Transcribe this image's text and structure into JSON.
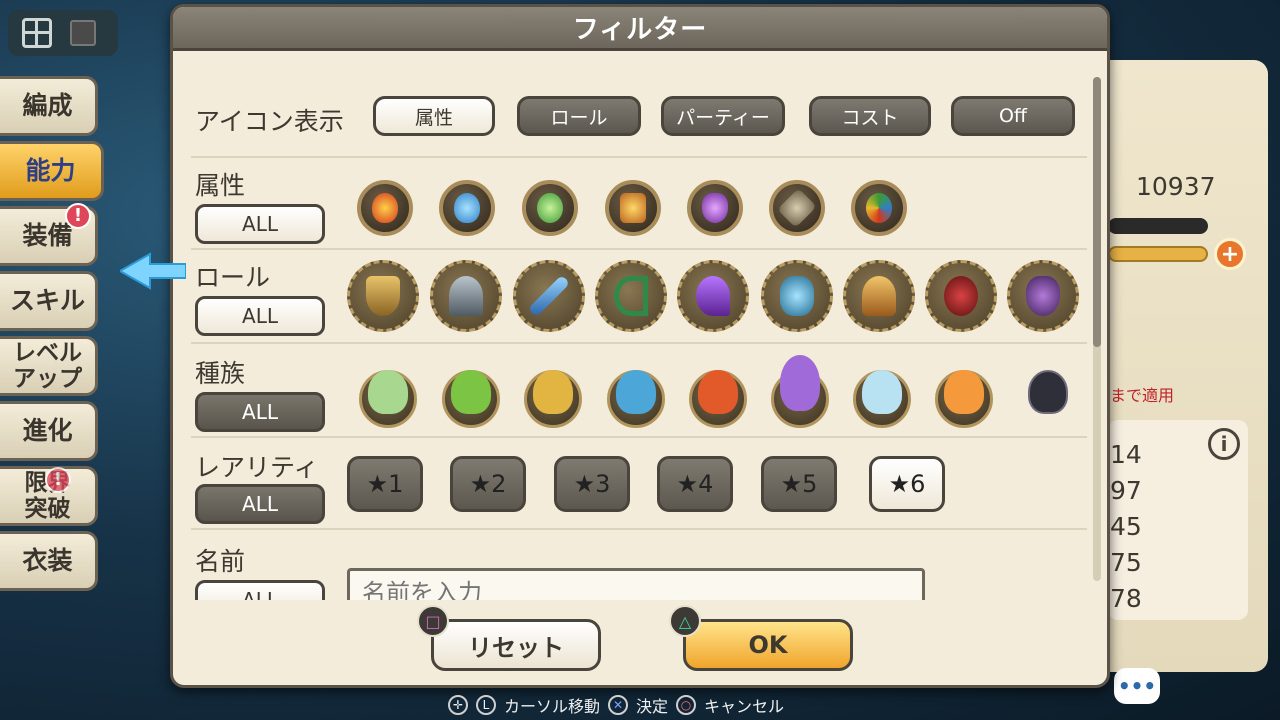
{
  "dialog": {
    "title": "フィルター",
    "rows": {
      "icon_display": {
        "label": "アイコン表示",
        "options": [
          "属性",
          "ロール",
          "パーティー",
          "コスト",
          "Off"
        ],
        "selected": "属性"
      },
      "attribute": {
        "label": "属性",
        "all_label": "ALL",
        "all_selected": true,
        "medals": [
          "fire-icon",
          "water-icon",
          "wind-icon",
          "earth-icon",
          "dark-eye-icon",
          "light-icon",
          "multi-element-icon"
        ]
      },
      "role": {
        "label": "ロール",
        "all_label": "ALL",
        "all_selected": true,
        "medals": [
          "shield-role-icon",
          "axe-role-icon",
          "sword-role-icon",
          "bow-role-icon",
          "staff-role-icon",
          "flower-role-icon",
          "harp-role-icon",
          "demon-role-icon",
          "mask-role-icon"
        ]
      },
      "race": {
        "label": "種族",
        "all_label": "ALL",
        "all_selected": false,
        "medals": [
          "humanoid-race-icon",
          "plant-race-icon",
          "beast-race-icon",
          "aquatic-race-icon",
          "slime-race-icon",
          "rabbit-race-icon",
          "dragon-race-icon",
          "spirit-race-icon",
          "dark-race-icon"
        ]
      },
      "rarity": {
        "label": "レアリティ",
        "all_label": "ALL",
        "all_selected": false,
        "stars": [
          "★1",
          "★2",
          "★3",
          "★4",
          "★5",
          "★6"
        ],
        "selected": "★6"
      },
      "name": {
        "label": "名前",
        "all_label": "ALL",
        "placeholder": "名前を入力"
      }
    },
    "buttons": {
      "reset": "リセット",
      "ok": "OK"
    }
  },
  "side_tabs": [
    {
      "label": "編成",
      "active": false
    },
    {
      "label": "能力",
      "active": true
    },
    {
      "label": "装備",
      "active": false,
      "badge": "!"
    },
    {
      "label": "スキル",
      "active": false
    },
    {
      "label": "レベル\nアップ",
      "active": false
    },
    {
      "label": "進化",
      "active": false
    },
    {
      "label": "限界\n突破",
      "active": false,
      "badge": "!"
    },
    {
      "label": "衣装",
      "active": false
    }
  ],
  "background": {
    "value": "10937",
    "note": "まで適用",
    "list_values": [
      "14",
      "97",
      "45",
      "75",
      "78"
    ]
  },
  "hints": {
    "move": "カーソル移動",
    "confirm": "決定",
    "cancel": "キャンセル"
  },
  "colors": {
    "accent_ok": "#f0a52c",
    "active_tab": "#e09c1c",
    "dialog_bg": "#f3ecdb"
  }
}
